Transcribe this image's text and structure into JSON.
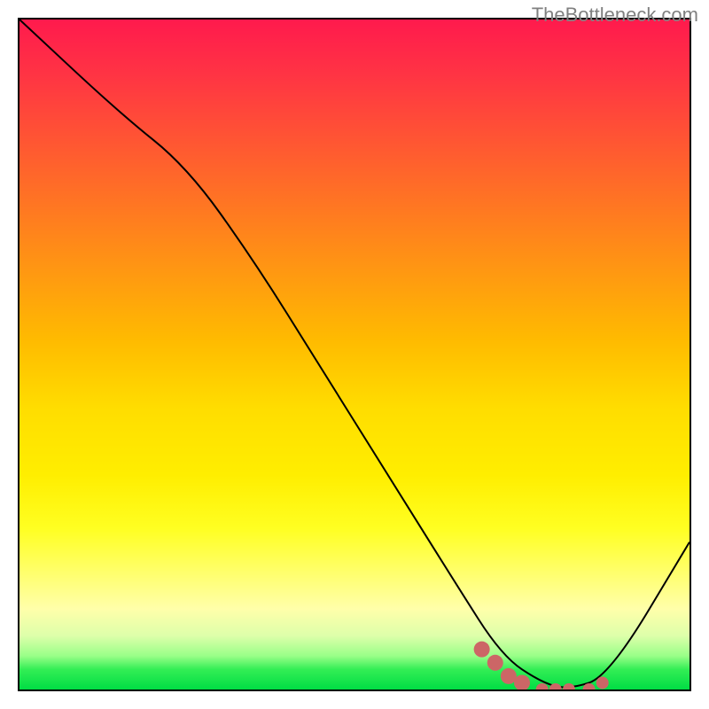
{
  "watermark": "TheBottleneck.com",
  "chart_data": {
    "type": "line",
    "title": "",
    "xlabel": "",
    "ylabel": "",
    "xlim": [
      0,
      100
    ],
    "ylim": [
      0,
      100
    ],
    "series": [
      {
        "name": "bottleneck-curve",
        "x": [
          0,
          15,
          25,
          35,
          45,
          55,
          65,
          72,
          78,
          82,
          88,
          100
        ],
        "values": [
          100,
          86,
          78,
          64,
          48,
          32,
          16,
          5,
          1,
          0,
          2,
          22
        ]
      }
    ],
    "marker_points": {
      "name": "optimal-range",
      "x": [
        69,
        71,
        73,
        75,
        78,
        80,
        82,
        85,
        87
      ],
      "values": [
        6,
        4,
        2,
        1,
        0,
        0,
        0,
        0,
        1
      ]
    },
    "gradient_colors": {
      "top": "#ff1a4d",
      "mid": "#ffee00",
      "bottom": "#00dd44"
    }
  }
}
